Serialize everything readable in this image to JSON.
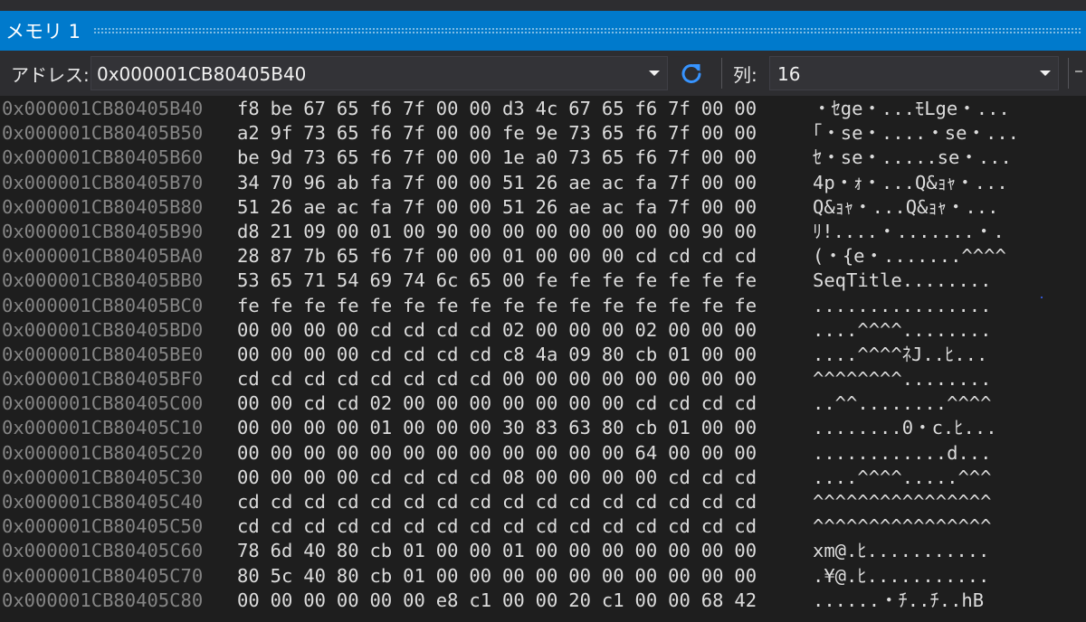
{
  "window": {
    "title": "メモリ 1"
  },
  "toolbar": {
    "address_label": "アドレス:",
    "address_value": "0x000001CB80405B40",
    "refresh_icon": "refresh-icon",
    "columns_label": "列:",
    "columns_value": "16"
  },
  "memory": {
    "rows": [
      {
        "addr": "0x000001CB80405B40",
        "hex": "f8 be 67 65 f6 7f 00 00 d3 4c 67 65 f6 7f 00 00",
        "text": "・ｾge・...ﾓLge・..."
      },
      {
        "addr": "0x000001CB80405B50",
        "hex": "a2 9f 73 65 f6 7f 00 00 fe 9e 73 65 f6 7f 00 00",
        "text": "｢・se・....・se・..."
      },
      {
        "addr": "0x000001CB80405B60",
        "hex": "be 9d 73 65 f6 7f 00 00 1e a0 73 65 f6 7f 00 00",
        "text": "ｾ・se・.....se・..."
      },
      {
        "addr": "0x000001CB80405B70",
        "hex": "34 70 96 ab fa 7f 00 00 51 26 ae ac fa 7f 00 00",
        "text": "4p・ｫ・...Q&ｮｬ・..."
      },
      {
        "addr": "0x000001CB80405B80",
        "hex": "51 26 ae ac fa 7f 00 00 51 26 ae ac fa 7f 00 00",
        "text": "Q&ｮｬ・...Q&ｮｬ・..."
      },
      {
        "addr": "0x000001CB80405B90",
        "hex": "d8 21 09 00 01 00 90 00 00 00 00 00 00 00 90 00",
        "text": "ﾘ!....・.......・."
      },
      {
        "addr": "0x000001CB80405BA0",
        "hex": "28 87 7b 65 f6 7f 00 00 01 00 00 00 cd cd cd cd",
        "text": "(・{e・.......^^^^"
      },
      {
        "addr": "0x000001CB80405BB0",
        "hex": "53 65 71 54 69 74 6c 65 00 fe fe fe fe fe fe fe",
        "text": "SeqTitle........"
      },
      {
        "addr": "0x000001CB80405BC0",
        "hex": "fe fe fe fe fe fe fe fe fe fe fe fe fe fe fe fe",
        "text": "................"
      },
      {
        "addr": "0x000001CB80405BD0",
        "hex": "00 00 00 00 cd cd cd cd 02 00 00 00 02 00 00 00",
        "text": "....^^^^........"
      },
      {
        "addr": "0x000001CB80405BE0",
        "hex": "00 00 00 00 cd cd cd cd c8 4a 09 80 cb 01 00 00",
        "text": "....^^^^ﾈJ..ﾋ..."
      },
      {
        "addr": "0x000001CB80405BF0",
        "hex": "cd cd cd cd cd cd cd cd 00 00 00 00 00 00 00 00",
        "text": "^^^^^^^^........"
      },
      {
        "addr": "0x000001CB80405C00",
        "hex": "00 00 cd cd 02 00 00 00 00 00 00 00 cd cd cd cd",
        "text": "..^^........^^^^"
      },
      {
        "addr": "0x000001CB80405C10",
        "hex": "00 00 00 00 01 00 00 00 30 83 63 80 cb 01 00 00",
        "text": "........0・c.ﾋ..."
      },
      {
        "addr": "0x000001CB80405C20",
        "hex": "00 00 00 00 00 00 00 00 00 00 00 00 64 00 00 00",
        "text": "............d..."
      },
      {
        "addr": "0x000001CB80405C30",
        "hex": "00 00 00 00 cd cd cd cd 08 00 00 00 00 cd cd cd",
        "text": "....^^^^.....^^^"
      },
      {
        "addr": "0x000001CB80405C40",
        "hex": "cd cd cd cd cd cd cd cd cd cd cd cd cd cd cd cd",
        "text": "^^^^^^^^^^^^^^^^"
      },
      {
        "addr": "0x000001CB80405C50",
        "hex": "cd cd cd cd cd cd cd cd cd cd cd cd cd cd cd cd",
        "text": "^^^^^^^^^^^^^^^^"
      },
      {
        "addr": "0x000001CB80405C60",
        "hex": "78 6d 40 80 cb 01 00 00 01 00 00 00 00 00 00 00",
        "text": "xm@.ﾋ..........."
      },
      {
        "addr": "0x000001CB80405C70",
        "hex": "80 5c 40 80 cb 01 00 00 00 00 00 00 00 00 00 00",
        "text": ".¥@.ﾋ..........."
      },
      {
        "addr": "0x000001CB80405C80",
        "hex": "00 00 00 00 00 00 e8 c1 00 00 20 c1 00 00 68 42",
        "text": "......・ﾁ..ﾁ..hB"
      }
    ]
  },
  "colors": {
    "accent": "#007acc",
    "background": "#1e1e1e",
    "toolbar": "#2d2d30",
    "address_text": "#858585",
    "data_text": "#dcdcdc",
    "refresh_icon": "#3794ff"
  }
}
